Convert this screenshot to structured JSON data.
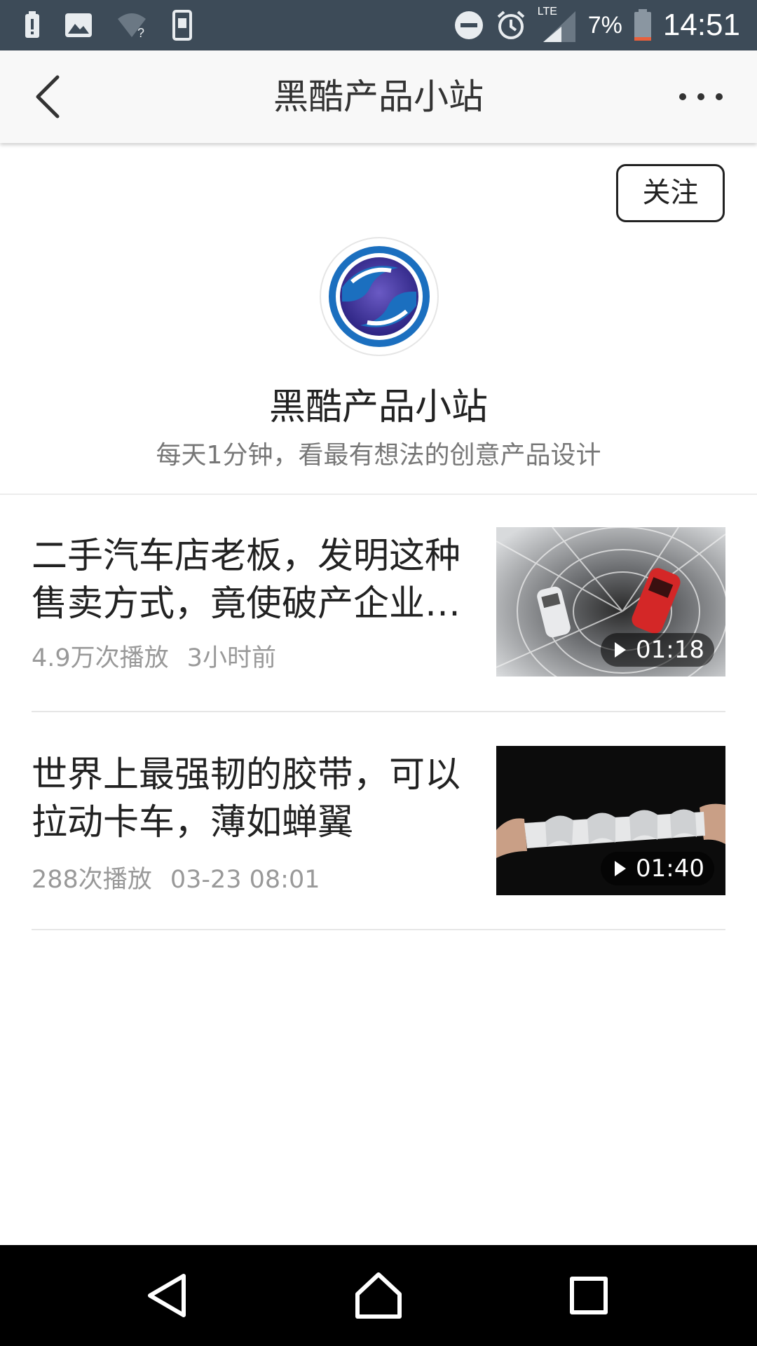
{
  "status_bar": {
    "battery_percent": "7%",
    "time": "14:51",
    "network": "LTE",
    "icons": [
      "battery-alert-icon",
      "image-icon",
      "wifi-question-icon",
      "phone-icon",
      "dnd-icon",
      "alarm-icon",
      "signal-icon",
      "battery-icon"
    ]
  },
  "header": {
    "title": "黑酷产品小站",
    "back_icon": "chevron-left-icon",
    "more_icon": "more-horizontal-icon"
  },
  "profile": {
    "follow_label": "关注",
    "name": "黑酷产品小站",
    "description": "每天1分钟，看最有想法的创意产品设计",
    "avatar_icon": "channel-logo-icon",
    "logo_colors": [
      "#1b6fbf",
      "#3a2f8f"
    ]
  },
  "videos": [
    {
      "title": "二手汽车店老板，发明这种售卖方式，竟使破产企业…",
      "views": "4.9万次播放",
      "time": "3小时前",
      "duration": "01:18",
      "thumb_icon": "car-tower-thumbnail"
    },
    {
      "title": "世界上最强韧的胶带，可以拉动卡车，薄如蝉翼",
      "views": "288次播放",
      "time": "03-23 08:01",
      "duration": "01:40",
      "thumb_icon": "tape-thumbnail"
    }
  ],
  "nav_bar": {
    "back_icon": "triangle-back-icon",
    "home_icon": "home-icon",
    "recents_icon": "square-recents-icon"
  }
}
